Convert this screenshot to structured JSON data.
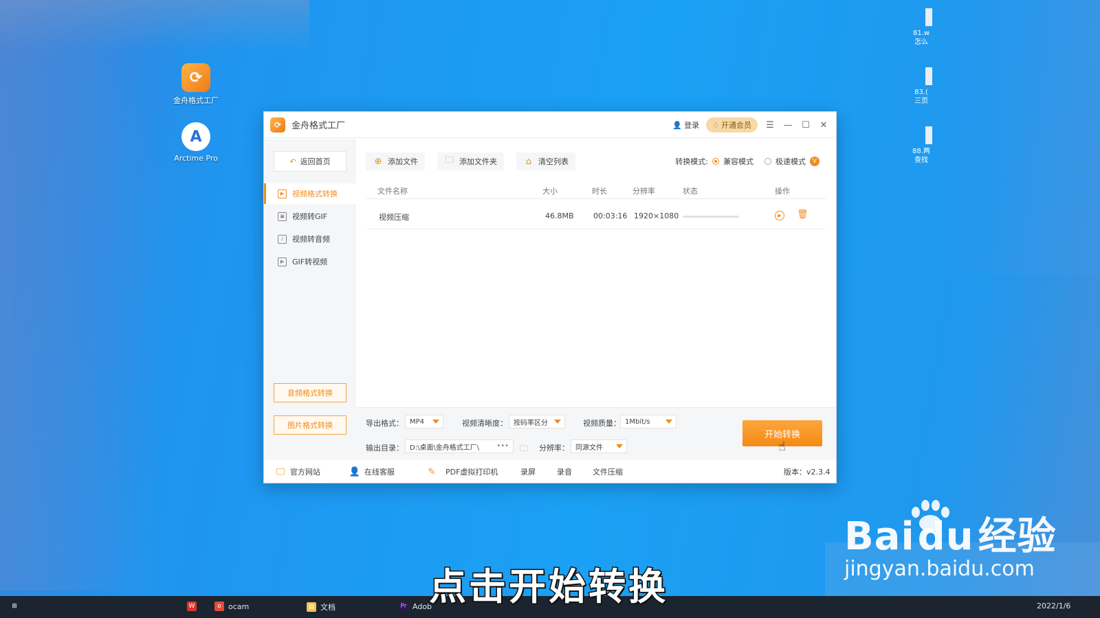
{
  "desktop": {
    "icons": [
      {
        "label": "金舟格式工厂",
        "icon": "jinzhou-app-icon"
      },
      {
        "label": "Arctime Pro",
        "icon": "arctime-app-icon"
      }
    ],
    "right_icons": [
      {
        "line1": "81.w",
        "line2": "怎么"
      },
      {
        "line1": "83.(",
        "line2": "三页"
      },
      {
        "line1": "88.两",
        "line2": "查找"
      }
    ]
  },
  "window": {
    "title": "金舟格式工厂",
    "login": "登录",
    "vip": "开通会员"
  },
  "sidebar": {
    "back": "返回首页",
    "items": [
      {
        "label": "视频格式转换",
        "active": true
      },
      {
        "label": "视频转GIF",
        "active": false
      },
      {
        "label": "视频转音频",
        "active": false
      },
      {
        "label": "GIF转视频",
        "active": false
      }
    ],
    "audio_btn": "音频格式转换",
    "image_btn": "图片格式转换"
  },
  "toolbar": {
    "add_file": "添加文件",
    "add_folder": "添加文件夹",
    "clear_list": "清空列表",
    "mode_label": "转换模式:",
    "mode_compat": "兼容模式",
    "mode_fast": "极速模式",
    "vip_badge": "V"
  },
  "table": {
    "headers": {
      "name": "文件名称",
      "size": "大小",
      "duration": "时长",
      "resolution": "分辨率",
      "status": "状态",
      "ops": "操作"
    },
    "rows": [
      {
        "name": "视频压缩",
        "size": "46.8MB",
        "duration": "00:03:16",
        "resolution": "1920×1080",
        "progress": 0
      }
    ]
  },
  "settings": {
    "format_label": "导出格式：",
    "format_value": "MP4",
    "clarity_label": "视频清晰度：",
    "clarity_value": "按码率区分",
    "quality_label": "视频质量：",
    "quality_value": "1Mbit/s",
    "output_label": "输出目录：",
    "output_value": "D:\\桌面\\金舟格式工厂\\",
    "output_more": "•••",
    "resolution_label": "分辨率：",
    "resolution_value": "同源文件",
    "start": "开始转换"
  },
  "footer": {
    "website": "官方网站",
    "service": "在线客服",
    "pdf": "PDF虚拟打印机",
    "record_screen": "录屏",
    "record_audio": "录音",
    "compress": "文件压缩",
    "version": "版本：v2.3.4"
  },
  "taskbar": {
    "items": [
      "ocam",
      "文档",
      "Adob"
    ],
    "date": "2022/1/6"
  },
  "overlay": {
    "subtitle": "点击开始转换",
    "brand": "Bai",
    "brand_du": "du",
    "brand_cn": "经验",
    "url": "jingyan.baidu.com"
  },
  "colors": {
    "accent": "#f08c1e",
    "desktop": "#1aa0f4"
  }
}
